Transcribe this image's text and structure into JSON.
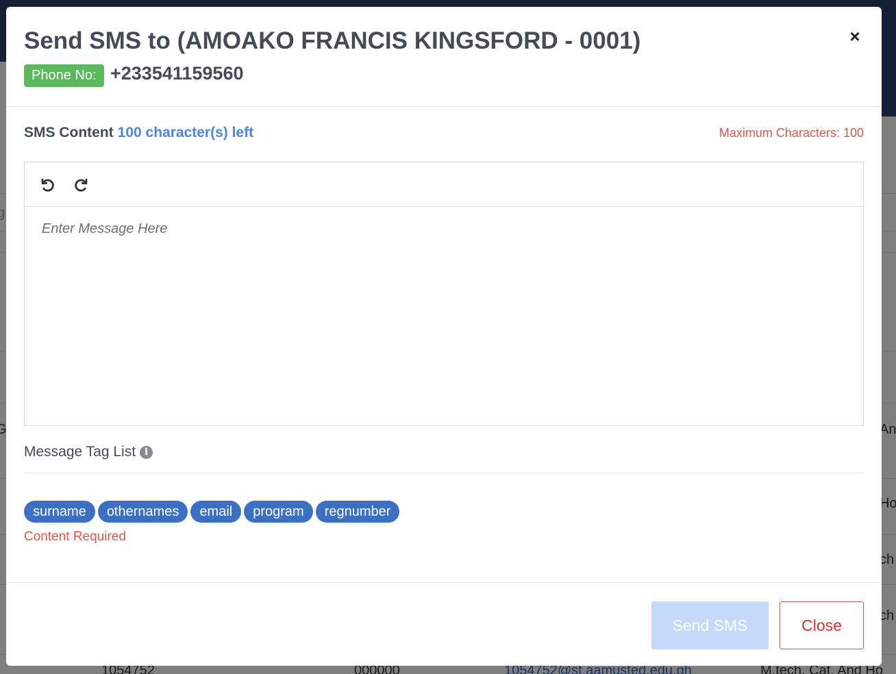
{
  "modal": {
    "title": "Send SMS to (AMOAKO FRANCIS KINGSFORD - 0001)",
    "phone_label": "Phone No:",
    "phone_number": "+233541159560",
    "close_symbol": "×"
  },
  "sms": {
    "content_label": "SMS Content",
    "chars_left": "100 character(s) left",
    "max_chars": "Maximum Characters: 100",
    "placeholder": "Enter Message Here",
    "value": ""
  },
  "toolbar": {
    "undo_icon": "undo-icon",
    "redo_icon": "redo-icon"
  },
  "tags": {
    "title": "Message Tag List",
    "info_icon": "i",
    "items": [
      "surname",
      "othernames",
      "email",
      "program",
      "regnumber"
    ],
    "error": "Content Required"
  },
  "footer": {
    "send_label": "Send SMS",
    "close_label": "Close"
  },
  "background": {
    "row_texts": [
      "1054752",
      "000000",
      "1054752@st.aamusted.edu.gh",
      "M.tech. Cat. And Ho"
    ],
    "right_fragments": [
      "An",
      "Ho",
      "ch",
      "ch"
    ],
    "left_fragments": [
      "g",
      "G"
    ]
  },
  "colors": {
    "badge_green": "#5cb85c",
    "accent_blue": "#4a86e8",
    "tag_blue": "#3a6fc4",
    "error_red": "#e0544c",
    "send_disabled": "#c5d9fa"
  }
}
